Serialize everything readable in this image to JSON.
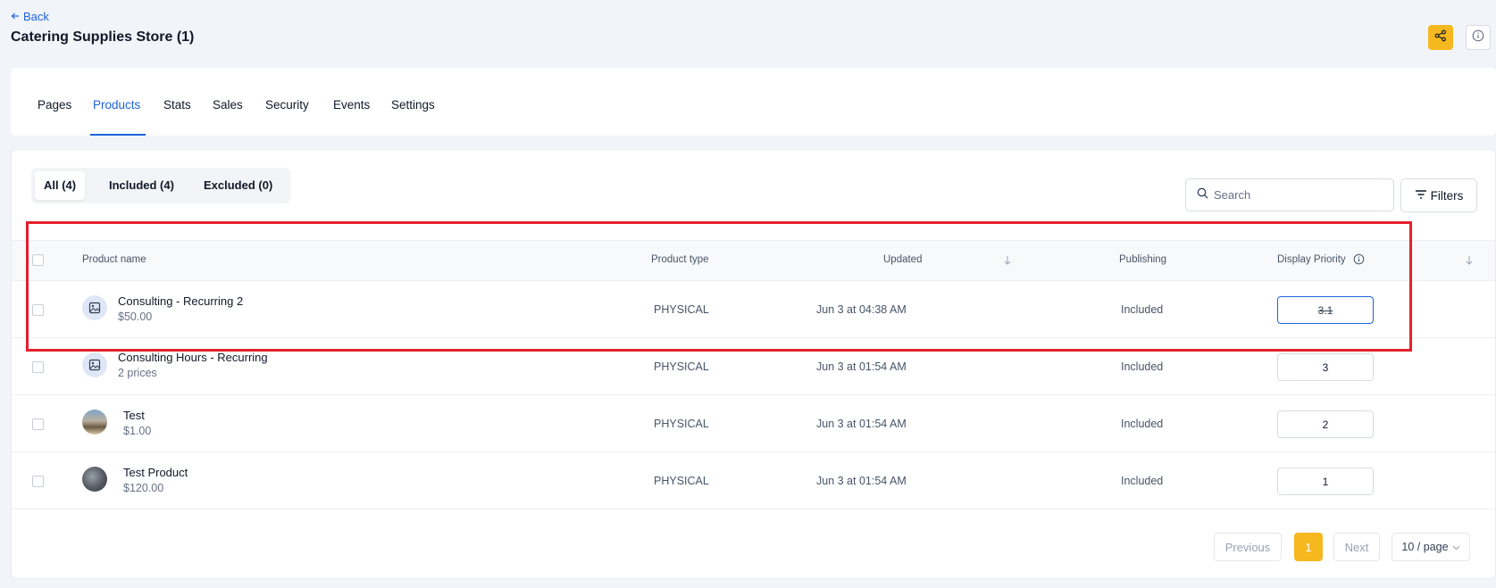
{
  "header": {
    "back_label": "Back",
    "title": "Catering Supplies Store (1)"
  },
  "nav_tabs": [
    {
      "label": "Pages",
      "active": false
    },
    {
      "label": "Products",
      "active": true
    },
    {
      "label": "Stats",
      "active": false
    },
    {
      "label": "Sales",
      "active": false
    },
    {
      "label": "Security",
      "active": false
    },
    {
      "label": "Events",
      "active": false
    },
    {
      "label": "Settings",
      "active": false
    }
  ],
  "filter_tabs": [
    {
      "label": "All (4)",
      "active": true
    },
    {
      "label": "Included (4)",
      "active": false
    },
    {
      "label": "Excluded (0)",
      "active": false
    }
  ],
  "search": {
    "placeholder": "Search"
  },
  "filters_label": "Filters",
  "table": {
    "columns": {
      "product_name": "Product name",
      "product_type": "Product type",
      "updated": "Updated",
      "publishing": "Publishing",
      "display_priority": "Display Priority"
    },
    "rows": [
      {
        "name": "Consulting - Recurring 2",
        "sub": "$50.00",
        "type": "PHYSICAL",
        "updated": "Jun 3 at 04:38 AM",
        "publishing": "Included",
        "priority": "3.1",
        "thumb": "image-placeholder-icon"
      },
      {
        "name": "Consulting Hours - Recurring",
        "sub": "2 prices",
        "type": "PHYSICAL",
        "updated": "Jun 3 at 01:54 AM",
        "publishing": "Included",
        "priority": "3",
        "thumb": "image-placeholder-icon"
      },
      {
        "name": "Test",
        "sub": "$1.00",
        "type": "PHYSICAL",
        "updated": "Jun 3 at 01:54 AM",
        "publishing": "Included",
        "priority": "2",
        "thumb": "photo-thumbnail"
      },
      {
        "name": "Test Product",
        "sub": "$120.00",
        "type": "PHYSICAL",
        "updated": "Jun 3 at 01:54 AM",
        "publishing": "Included",
        "priority": "1",
        "thumb": "photo-thumbnail"
      }
    ]
  },
  "pagination": {
    "previous_label": "Previous",
    "current_page": "1",
    "next_label": "Next",
    "per_page": "10 / page"
  },
  "colors": {
    "accent_blue": "#1d63db",
    "accent_yellow": "#f5b81f",
    "highlight_red": "#e4202c"
  }
}
